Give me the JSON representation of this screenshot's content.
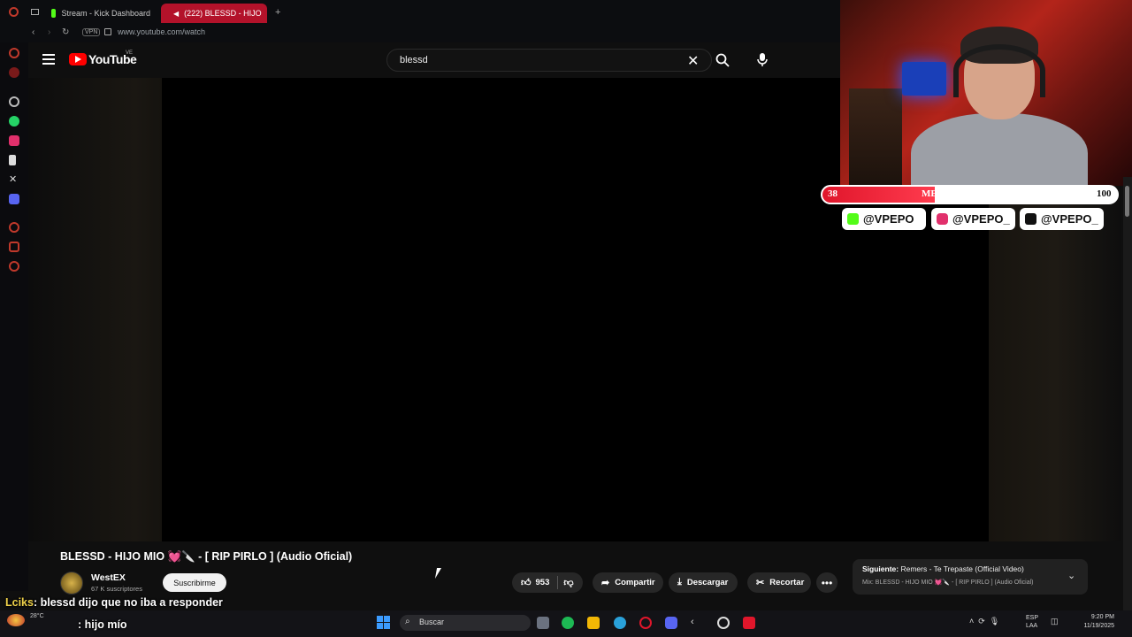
{
  "browser": {
    "tabs": [
      {
        "label": "Stream - Kick Dashboard",
        "active": false
      },
      {
        "label": "(222) BLESSD - HIJO",
        "active": true
      }
    ],
    "new_tab": "+",
    "url": "www.youtube.com/watch",
    "vpn": "VPN"
  },
  "youtube": {
    "wordmark": "YouTube",
    "country": "VE",
    "search_value": "blessd"
  },
  "video": {
    "title": "BLESSD - HIJO MIO 💓🔪 - [ RIP PIRLO ] (Audio Oficial)",
    "channel": "WestEX",
    "subscribers": "67 K suscriptores",
    "subscribe_label": "Suscribirme",
    "likes": "953",
    "share_label": "Compartir",
    "download_label": "Descargar",
    "clip_label": "Recortar",
    "more_label": "•••"
  },
  "up_next": {
    "prefix": "Siguiente:",
    "title": "Remers - Te Trepaste (Official Video)",
    "mix": "Mix: BLESSD - HIJO MIO 💓🔪 - [ RIP PIRLO ] (Audio Oficial)"
  },
  "stream_overlay": {
    "goal_label": "ME TIÑO EL PELO",
    "goal_current": "38",
    "goal_target": "100",
    "goal_fraction": 0.38,
    "socials": [
      {
        "platform": "kick",
        "handle": "@VPEPO",
        "color": "#53fc18"
      },
      {
        "platform": "instagram",
        "handle": "@VPEPO_",
        "color": "#e1306c"
      },
      {
        "platform": "tiktok",
        "handle": "@VPEPO_",
        "color": "#111111"
      }
    ]
  },
  "chat": [
    {
      "user": "Lciks",
      "message": ": blessd dijo que no iba a responder"
    },
    {
      "user": "",
      "message": ": hijo mío"
    }
  ],
  "taskbar": {
    "weather": "28°C",
    "search_label": "Buscar",
    "lang_top": "ESP",
    "lang_bottom": "LAA",
    "time": "9:20 PM",
    "date": "11/19/2025"
  },
  "colors": {
    "youtube_red": "#ff0000",
    "active_tab": "#b3122a",
    "goal_fill": "#e0162b"
  }
}
